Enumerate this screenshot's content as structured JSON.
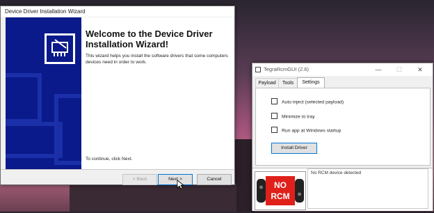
{
  "wizard": {
    "title": "Device Driver Installation Wizard",
    "heading": "Welcome to the Device Driver Installation Wizard!",
    "description": "This wizard helps you install the software drivers that some computers devices need in order to work.",
    "continue_text": "To continue, click Next.",
    "buttons": {
      "back": "< Back",
      "next": "Next >",
      "cancel": "Cancel"
    }
  },
  "tegra": {
    "title": "TegraRcmGUI (2.6)",
    "controls": {
      "minimize": "—",
      "maximize": "☐",
      "close": "✕"
    },
    "tabs": [
      {
        "label": "Payload"
      },
      {
        "label": "Tools"
      },
      {
        "label": "Settings"
      }
    ],
    "settings": {
      "options": [
        {
          "label": "Auto inject (selected payload)",
          "checked": false
        },
        {
          "label": "Minimize to tray",
          "checked": false
        },
        {
          "label": "Run app at Windows startup",
          "checked": false
        }
      ],
      "install_button": "Install Driver"
    },
    "status": {
      "badge_line1": "NO",
      "badge_line2": "RCM",
      "message": "No RCM device detected"
    }
  },
  "colors": {
    "wizard_side": "#0a1a8a",
    "accent_blue": "#0078d7",
    "rcm_red": "#e0201a",
    "joycon_dark": "#222222"
  }
}
